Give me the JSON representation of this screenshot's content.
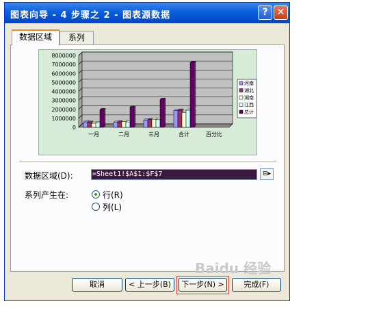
{
  "window": {
    "title": "图表向导 - 4 步骤之 2 - 图表源数据",
    "help_glyph": "?",
    "close_glyph": "✕"
  },
  "tabs": [
    {
      "label": "数据区域",
      "active": true
    },
    {
      "label": "系列",
      "active": false
    }
  ],
  "chart_data": {
    "type": "bar",
    "categories": [
      "一月",
      "二月",
      "三月",
      "合计",
      "百分比"
    ],
    "yticks": [
      "8000000",
      "7000000",
      "6000000",
      "5000000",
      "4000000",
      "3000000",
      "2000000",
      "1000000",
      "0"
    ],
    "ylim": [
      0,
      8000000
    ],
    "series": [
      {
        "name": "河南",
        "color": "#9999ff",
        "values": [
          600000,
          550000,
          800000,
          1850000,
          0
        ]
      },
      {
        "name": "湖北",
        "color": "#993366",
        "values": [
          550000,
          600000,
          850000,
          1900000,
          0
        ]
      },
      {
        "name": "湖南",
        "color": "#ffffcc",
        "values": [
          450000,
          650000,
          900000,
          1650000,
          0
        ]
      },
      {
        "name": "江西",
        "color": "#ccffff",
        "values": [
          500000,
          600000,
          850000,
          1900000,
          0
        ]
      },
      {
        "name": "总计",
        "color": "#660066",
        "values": [
          1950000,
          2250000,
          3100000,
          7200000,
          0
        ]
      }
    ],
    "legend": "right",
    "grid": true
  },
  "form": {
    "range_label": "数据区域(D):",
    "range_value": "=Sheet1!$A$1:$F$7",
    "series_in_label": "系列产生在:",
    "option_rows": "行(R)",
    "option_cols": "列(L)",
    "selected": "rows"
  },
  "buttons": {
    "cancel": "取消",
    "back": "< 上一步(B)",
    "next": "下一步(N) >",
    "finish": "完成(F)"
  },
  "watermark": "Baidu 经验"
}
